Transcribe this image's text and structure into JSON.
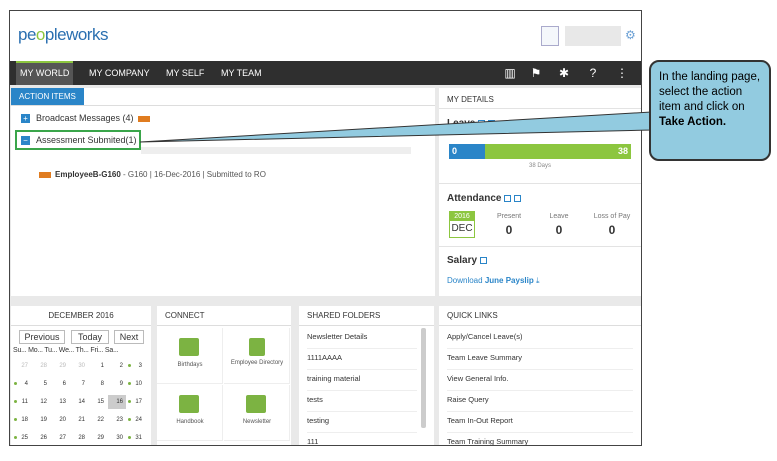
{
  "app": {
    "logo_part1": "pe",
    "logo_o1": "o",
    "logo_part2": "ple",
    "logo_part3": "works"
  },
  "nav": {
    "tabs": [
      "MY WORLD",
      "MY COMPANY",
      "MY SELF",
      "MY TEAM"
    ],
    "active": "MY WORLD"
  },
  "action_items": {
    "tab_label": "ACTION ITEMS",
    "broadcast": "Broadcast Messages (4)",
    "assessment": "Assessment Submited(1)",
    "employee_name": "EmployeeB-G160",
    "employee_detail": " - G160 | 16-Dec-2016 | Submitted to RO"
  },
  "my_details": {
    "title": "MY DETAILS",
    "leave_title": "Leave",
    "leave_used": "0",
    "leave_total": "38",
    "leave_days_label": "38 Days",
    "leave_used_fraction": 0.0,
    "attendance_title": "Attendance",
    "cal_year": "2016",
    "cal_month": "DEC",
    "present_label": "Present",
    "present_value": "0",
    "leave_label": "Leave",
    "leave_value": "0",
    "lop_label": "Loss of Pay",
    "lop_value": "0",
    "salary_title": "Salary",
    "salary_prefix": "Download ",
    "salary_link": "June Payslip"
  },
  "calendar": {
    "title": "DECEMBER 2016",
    "prev": "Previous",
    "today": "Today",
    "next": "Next",
    "dow": "Su... Mo... Tu... We... Th... Fri... Sa...",
    "rows": [
      [
        "27",
        "28",
        "29",
        "30",
        "1",
        "2",
        "3"
      ],
      [
        "4",
        "5",
        "6",
        "7",
        "8",
        "9",
        "10"
      ],
      [
        "11",
        "12",
        "13",
        "14",
        "15",
        "16",
        "17"
      ],
      [
        "18",
        "19",
        "20",
        "21",
        "22",
        "23",
        "24"
      ],
      [
        "25",
        "26",
        "27",
        "28",
        "29",
        "30",
        "31"
      ]
    ]
  },
  "connect": {
    "title": "CONNECT",
    "tiles": [
      "Birthdays",
      "Employee Directory",
      "Handbook",
      "Newsletter"
    ]
  },
  "shared": {
    "title": "SHARED FOLDERS",
    "items": [
      "Newsletter Details",
      "1111AAAA",
      "training material",
      "tests",
      "testing",
      "111"
    ]
  },
  "quick_links": {
    "title": "QUICK LINKS",
    "items": [
      "Apply/Cancel Leave(s)",
      "Team Leave Summary",
      "View General Info.",
      "Raise Query",
      "Team In-Out Report",
      "Team Training Summary"
    ]
  },
  "callout": {
    "text": "In the landing page, select the action item and click on ",
    "bold": "Take Action."
  },
  "colors": {
    "accent_blue": "#2a85c8",
    "accent_green": "#8cc63f",
    "nav_bg": "#2f2f2f",
    "callout_bg": "#92cbe0"
  }
}
